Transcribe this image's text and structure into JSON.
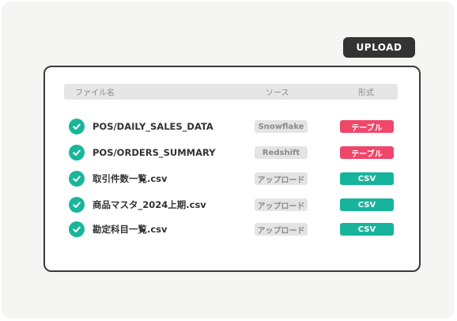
{
  "toolbar": {
    "upload_label": "UPLOAD"
  },
  "table": {
    "headers": {
      "name": "ファイル名",
      "source": "ソース",
      "format": "形式"
    },
    "rows": [
      {
        "name": "POS/DAILY_SALES_DATA",
        "source": "Snowflake",
        "format": "テーブル",
        "format_color": "#f0466a"
      },
      {
        "name": "POS/ORDERS_SUMMARY",
        "source": "Redshift",
        "format": "テーブル",
        "format_color": "#f0466a"
      },
      {
        "name": "取引件数一覧.csv",
        "source": "アップロード",
        "format": "CSV",
        "format_color": "#16b49a"
      },
      {
        "name": "商品マスタ_2024上期.csv",
        "source": "アップロード",
        "format": "CSV",
        "format_color": "#16b49a"
      },
      {
        "name": "勘定科目一覧.csv",
        "source": "アップロード",
        "format": "CSV",
        "format_color": "#16b49a"
      }
    ]
  },
  "colors": {
    "check": "#18b69b",
    "table_badge": "#f0466a",
    "csv_badge": "#16b49a"
  },
  "icons": {
    "row_status": "check-circle-icon"
  }
}
